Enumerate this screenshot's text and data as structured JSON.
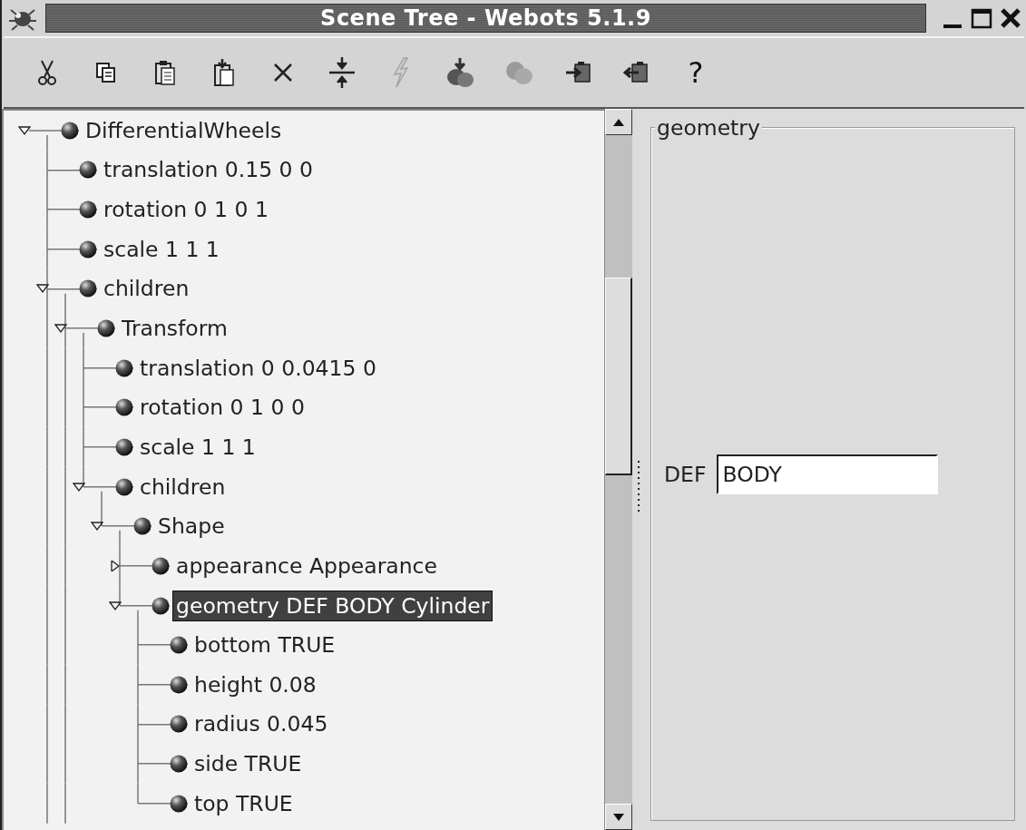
{
  "window": {
    "title": "Scene Tree - Webots 5.1.9"
  },
  "toolbar": [
    {
      "kind": "cut",
      "disabled": false
    },
    {
      "kind": "copy",
      "disabled": false
    },
    {
      "kind": "paste",
      "disabled": false
    },
    {
      "kind": "paste-after",
      "disabled": false
    },
    {
      "kind": "delete",
      "disabled": false
    },
    {
      "kind": "collapse",
      "disabled": false
    },
    {
      "kind": "lightning",
      "disabled": true
    },
    {
      "kind": "insert",
      "disabled": false
    },
    {
      "kind": "node",
      "disabled": true
    },
    {
      "kind": "import",
      "disabled": false
    },
    {
      "kind": "export",
      "disabled": false
    },
    {
      "kind": "help",
      "label": "?",
      "disabled": false
    }
  ],
  "tree": [
    {
      "label": "DifferentialWheels",
      "kind": "branch",
      "expanded": true,
      "more_below": true,
      "selected": false,
      "children": [
        {
          "label": "translation 0.15 0 0",
          "kind": "leaf",
          "selected": false
        },
        {
          "label": "rotation 0 1 0 1",
          "kind": "leaf",
          "selected": false
        },
        {
          "label": "scale 1 1 1",
          "kind": "leaf",
          "selected": false
        },
        {
          "label": "children",
          "kind": "branch",
          "expanded": true,
          "more_below": true,
          "selected": false,
          "children": [
            {
              "label": "Transform",
              "kind": "branch",
              "expanded": true,
              "more_below": false,
              "selected": false,
              "children": [
                {
                  "label": "translation 0 0.0415 0",
                  "kind": "leaf",
                  "selected": false
                },
                {
                  "label": "rotation 0 1 0 0",
                  "kind": "leaf",
                  "selected": false
                },
                {
                  "label": "scale 1 1 1",
                  "kind": "leaf",
                  "selected": false
                },
                {
                  "label": "children",
                  "kind": "branch",
                  "expanded": true,
                  "more_below": false,
                  "selected": false,
                  "children": [
                    {
                      "label": "Shape",
                      "kind": "branch",
                      "expanded": true,
                      "more_below": false,
                      "selected": false,
                      "children": [
                        {
                          "label": "appearance Appearance",
                          "kind": "branch",
                          "expanded": false,
                          "selected": false
                        },
                        {
                          "label": "geometry DEF BODY Cylinder",
                          "kind": "branch",
                          "expanded": true,
                          "more_below": false,
                          "selected": true,
                          "children": [
                            {
                              "label": "bottom TRUE",
                              "kind": "leaf",
                              "selected": false
                            },
                            {
                              "label": "height 0.08",
                              "kind": "leaf",
                              "selected": false
                            },
                            {
                              "label": "radius 0.045",
                              "kind": "leaf",
                              "selected": false
                            },
                            {
                              "label": "side TRUE",
                              "kind": "leaf",
                              "selected": false
                            },
                            {
                              "label": "top TRUE",
                              "kind": "leaf",
                              "selected": false
                            }
                          ]
                        }
                      ]
                    }
                  ]
                }
              ]
            }
          ]
        }
      ]
    }
  ],
  "panel": {
    "group_title": "geometry",
    "def_label": "DEF",
    "def_value": "BODY"
  }
}
